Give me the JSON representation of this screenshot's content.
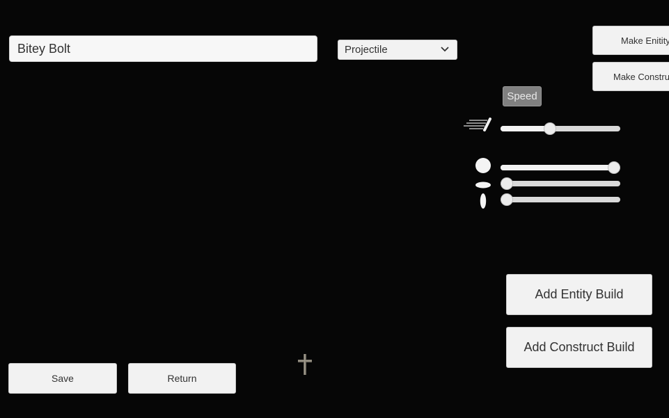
{
  "header": {
    "name_value": "Bitey Bolt",
    "type_select": {
      "selected": "Projectile"
    }
  },
  "top_right_buttons": {
    "make_entity": "Make Enitity",
    "make_construct": "Make Construct"
  },
  "speed": {
    "label": "Speed",
    "icon": "speed-lines-icon",
    "value": 0.41
  },
  "size_sliders": [
    {
      "icon": "circle-size-icon",
      "value": 1.0
    },
    {
      "icon": "horizontal-ellipse-icon",
      "value": 0.05
    },
    {
      "icon": "vertical-ellipse-icon",
      "value": 0.05
    }
  ],
  "builds": {
    "add_entity": "Add Entity Build",
    "add_construct": "Add Construct Build"
  },
  "footer": {
    "save": "Save",
    "return": "Return",
    "cursor_icon": "cross-cursor-icon"
  },
  "colors": {
    "background": "#060606",
    "button": "#f2f2f2",
    "speed_tag": "#808080"
  }
}
